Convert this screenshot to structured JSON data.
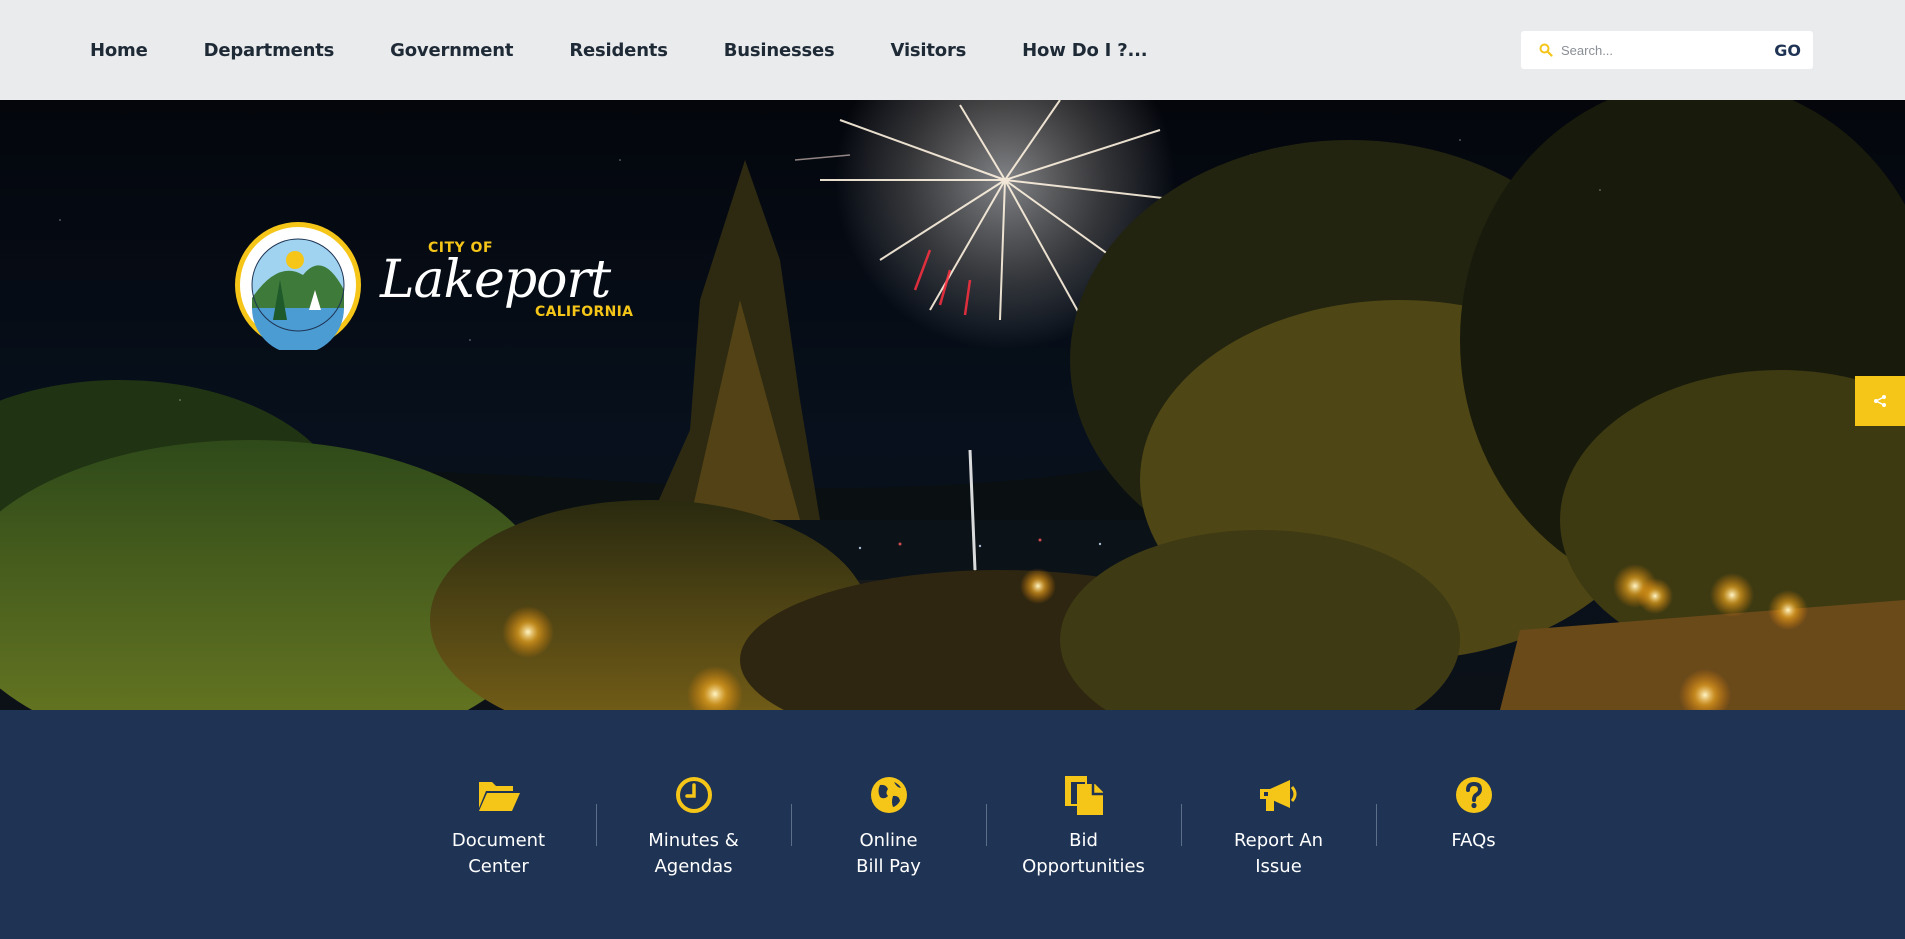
{
  "nav": {
    "items": [
      {
        "label": "Home"
      },
      {
        "label": "Departments"
      },
      {
        "label": "Government"
      },
      {
        "label": "Residents"
      },
      {
        "label": "Businesses"
      },
      {
        "label": "Visitors"
      },
      {
        "label": "How Do I ?..."
      }
    ],
    "search_placeholder": "Search...",
    "search_button": "GO"
  },
  "brand": {
    "city_of": "CITY OF",
    "name": "Lakeport",
    "state": "CALIFORNIA",
    "seal_icon": "city-seal-icon"
  },
  "hero": {
    "image_icon": "fireworks-over-lake-photo"
  },
  "share": {
    "icon": "share-icon"
  },
  "quick_links": [
    {
      "label": "Document\nCenter",
      "icon": "folder-open-icon"
    },
    {
      "label": "Minutes &\nAgendas",
      "icon": "clock-icon"
    },
    {
      "label": "Online\nBill Pay",
      "icon": "globe-icon"
    },
    {
      "label": "Bid\nOpportunities",
      "icon": "document-copy-icon"
    },
    {
      "label": "Report An\nIssue",
      "icon": "megaphone-icon"
    },
    {
      "label": "FAQs",
      "icon": "question-circle-icon"
    }
  ],
  "colors": {
    "accent": "#f5c518",
    "navy": "#1f3454",
    "topbar": "#eaebed"
  }
}
